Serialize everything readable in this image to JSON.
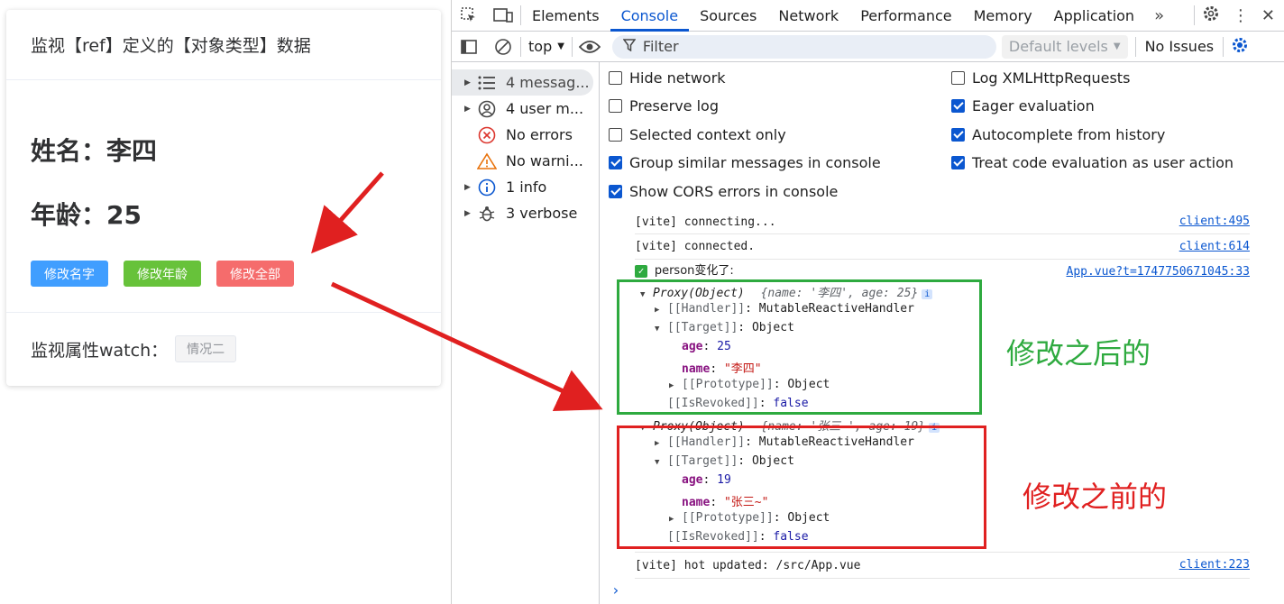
{
  "app": {
    "header_title": "监视【ref】定义的【对象类型】数据",
    "name_line": "姓名：李四",
    "age_line": "年龄：25",
    "buttons": {
      "edit_name": "修改名字",
      "edit_age": "修改年龄",
      "edit_all": "修改全部"
    },
    "footer_label": "监视属性watch：",
    "footer_tag": "情况二"
  },
  "devtools": {
    "tabs": [
      "Elements",
      "Console",
      "Sources",
      "Network",
      "Performance",
      "Memory",
      "Application"
    ],
    "active_tab": "Console",
    "toolbar": {
      "context": "top",
      "filter_placeholder": "Filter",
      "levels": "Default levels",
      "issues": "No Issues"
    },
    "sidebar": [
      {
        "label": "4 messag...",
        "icon": "list-icon"
      },
      {
        "label": "4 user m...",
        "icon": "user-icon"
      },
      {
        "label": "No errors",
        "icon": "error-icon"
      },
      {
        "label": "No warni...",
        "icon": "warning-icon"
      },
      {
        "label": "1 info",
        "icon": "info-icon"
      },
      {
        "label": "3 verbose",
        "icon": "bug-icon"
      }
    ],
    "settings": {
      "hide_network": "Hide network",
      "preserve_log": "Preserve log",
      "selected_context": "Selected context only",
      "group_similar": "Group similar messages in console",
      "show_cors": "Show CORS errors in console",
      "log_xhr": "Log XMLHttpRequests",
      "eager_eval": "Eager evaluation",
      "autocomplete": "Autocomplete from history",
      "treat_code": "Treat code evaluation as user action"
    },
    "console": {
      "line1": "[vite] connecting...",
      "line1_src": "client:495",
      "line2": "[vite] connected.",
      "line2_src": "client:614",
      "line3": "person变化了:",
      "line3_src": "App.vue?t=1747750671045:33",
      "proxy_new": {
        "head": "Proxy(Object)",
        "preview": "{name: '李四', age: 25}",
        "handler_key": "[[Handler]]",
        "handler_val": "MutableReactiveHandler",
        "target_key": "[[Target]]",
        "target_val": "Object",
        "age_key": "age",
        "age_val": "25",
        "name_key": "name",
        "name_val": "\"李四\"",
        "proto_key": "[[Prototype]]",
        "proto_val": "Object",
        "revoked_key": "[[IsRevoked]]",
        "revoked_val": "false"
      },
      "proxy_old": {
        "head": "Proxy(Object)",
        "preview": "{name: '张三~', age: 19}",
        "handler_key": "[[Handler]]",
        "handler_val": "MutableReactiveHandler",
        "target_key": "[[Target]]",
        "target_val": "Object",
        "age_key": "age",
        "age_val": "19",
        "name_key": "name",
        "name_val": "\"张三~\"",
        "proto_key": "[[Prototype]]",
        "proto_val": "Object",
        "revoked_key": "[[IsRevoked]]",
        "revoked_val": "false"
      },
      "line_last": "[vite] hot updated: /src/App.vue",
      "line_last_src": "client:223"
    }
  },
  "annotations": {
    "after_label": "修改之后的",
    "before_label": "修改之前的",
    "green": "#2eaa3f",
    "red": "#e02020"
  }
}
